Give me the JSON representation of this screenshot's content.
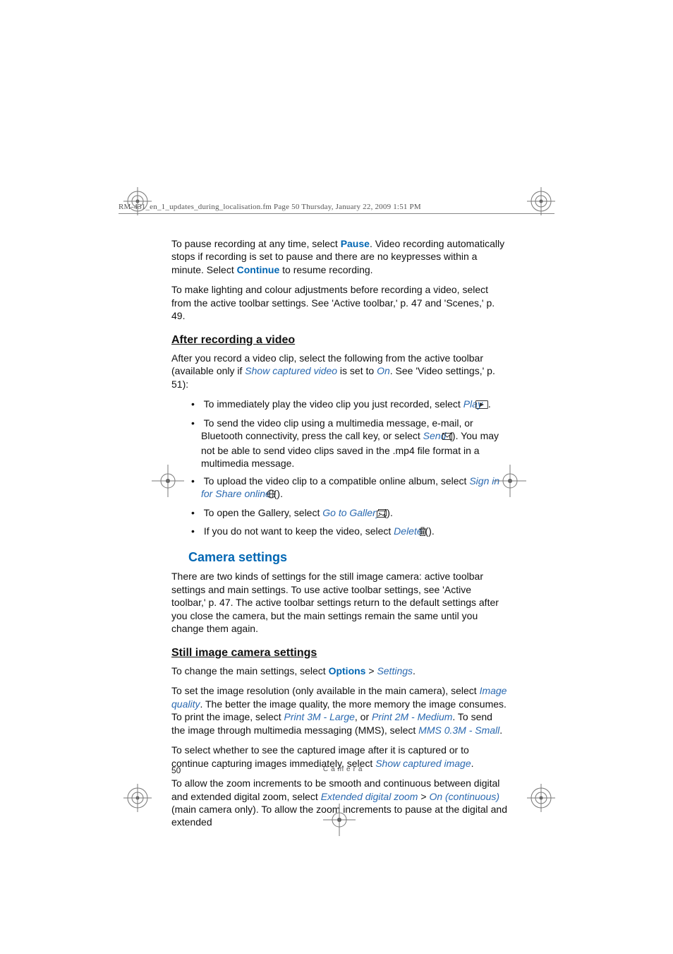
{
  "header": "RM-431_en_1_updates_during_localisation.fm  Page 50  Thursday, January 22, 2009  1:51 PM",
  "p1": {
    "a": "To pause recording at any time, select ",
    "pause": "Pause",
    "b": ". Video recording automatically stops if recording is set to pause and there are no keypresses within a minute. Select ",
    "continue": "Continue",
    "c": " to resume recording."
  },
  "p2": "To make lighting and colour adjustments before recording a video, select from the active toolbar settings. See 'Active toolbar,' p. 47 and 'Scenes,' p. 49.",
  "h_after": "After recording a video",
  "p3": {
    "a": "After you record a video clip, select the following from the active toolbar (available only if ",
    "scv": "Show captured video",
    "b": " is set to ",
    "on": "On",
    "c": ". See 'Video settings,' p. 51):"
  },
  "bul": {
    "i1a": "To immediately play the video clip you just recorded, select ",
    "play": "Play",
    "i1b": " ",
    "i1c": ".",
    "i2a": "To send the video clip using a multimedia message, e-mail, or Bluetooth connectivity, press the call key, or select ",
    "send": "Send",
    "i2b": " (",
    "i2c": "). You may not be able to send video clips saved in the .mp4 file format in a multimedia message.",
    "i3a": "To upload the video clip to a compatible online album, select ",
    "signin": "Sign in for Share online",
    "i3b": " (",
    "i3c": ").",
    "i4a": "To open the Gallery, select ",
    "gallery": "Go to Gallery",
    "i4b": " (",
    "i4c": ").",
    "i5a": "If you do not want to keep the video, select ",
    "delete": "Delete",
    "i5b": " (",
    "i5c": ")."
  },
  "h_cam_settings": "Camera settings",
  "p4": "There are two kinds of settings for the still image camera: active toolbar settings and main settings. To use active toolbar settings, see 'Active toolbar,' p. 47. The active toolbar settings return to the default settings after you close the camera, but the main settings remain the same until you change them again.",
  "h_still": "Still image camera settings",
  "p5": {
    "a": "To change the main settings, select ",
    "options": "Options",
    "gt": " > ",
    "settings": "Settings",
    "b": "."
  },
  "p6": {
    "a": "To set the image resolution (only available in the main camera), select ",
    "iq": "Image quality",
    "b": ". The better the image quality, the more memory the image consumes. To print the image, select ",
    "p3m": "Print 3M - Large",
    "c": ", or ",
    "p2m": "Print 2M - Medium",
    "d": ". To send the image through multimedia messaging (MMS), select ",
    "mms": "MMS 0.3M - Small",
    "e": "."
  },
  "p7": {
    "a": "To select whether to see the captured image after it is captured or to continue capturing images immediately, select ",
    "sci": "Show captured image",
    "b": "."
  },
  "p8": {
    "a": "To allow the zoom increments to be smooth and continuous between digital and extended digital zoom, select ",
    "edz": "Extended digital zoom",
    "gt": " > ",
    "onc": "On (continuous)",
    "b": " (main camera only). To allow the zoom increments to pause at the digital and extended"
  },
  "footer": {
    "page": "50",
    "title": "Camera"
  },
  "icons": {
    "play": "play-icon",
    "send": "envelope-icon",
    "share": "globe-icon",
    "gallery": "gallery-icon",
    "delete": "trash-icon"
  }
}
